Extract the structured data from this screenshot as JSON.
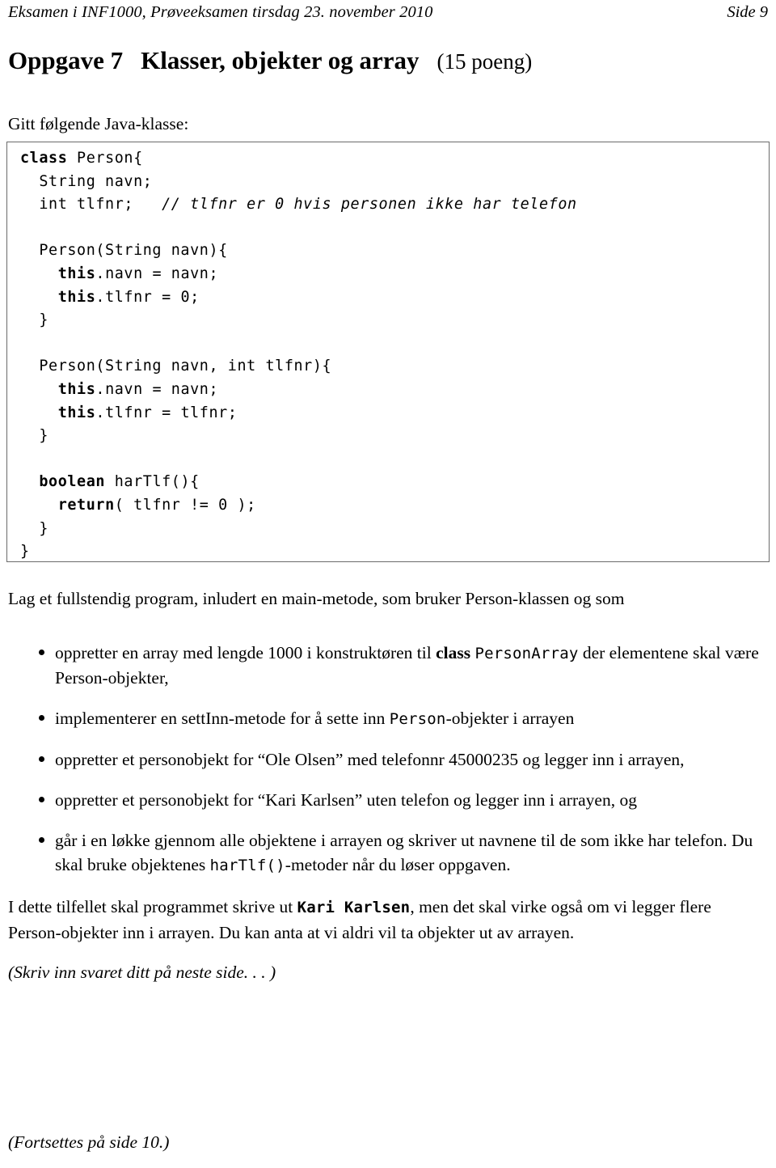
{
  "running_header": {
    "left": "Eksamen i INF1000, Prøveeksamen tirsdag 23. november 2010",
    "right": "Side 9"
  },
  "section": {
    "number_label": "Oppgave 7",
    "title": "Klasser, objekter og array",
    "points": "(15 poeng)"
  },
  "intro_line": "Gitt følgende Java-klasse:",
  "code_block": {
    "language": "java",
    "lines": [
      "class Person{",
      "  String navn;",
      "  int tlfnr;   // tlfnr er 0 hvis personen ikke har telefon",
      "",
      "  Person(String navn){",
      "    this.navn = navn;",
      "    this.tlfnr = 0;",
      "  }",
      "",
      "  Person(String navn, int tlfnr){",
      "    this.navn = navn;",
      "    this.tlfnr = tlfnr;",
      "  }",
      "",
      "  boolean harTlf(){",
      "    return( tlfnr != 0 );",
      "  }",
      "}"
    ],
    "keywords_bold": [
      "class",
      "this",
      "boolean",
      "return"
    ],
    "comment_italic": "// tlfnr er 0 hvis personen ikke har telefon"
  },
  "lead_paragraph": "Lag et fullstendig program, inludert en main-metode, som bruker Person-klassen og som",
  "bullets": [
    {
      "id": "bullet-array-konstruktor",
      "parts": [
        {
          "text": "oppretter en array med lengde 1000 i konstruktøren til ",
          "style": "normal"
        },
        {
          "text": "class",
          "style": "bold"
        },
        {
          "text": " ",
          "style": "normal"
        },
        {
          "text": "PersonArray",
          "style": "mono"
        },
        {
          "text": " der elementene skal være Person-objekter,",
          "style": "normal"
        }
      ]
    },
    {
      "id": "bullet-settinn",
      "parts": [
        {
          "text": "implementerer en settInn-metode for å sette inn ",
          "style": "normal"
        },
        {
          "text": "Person",
          "style": "mono"
        },
        {
          "text": "-objekter i arrayen",
          "style": "normal"
        }
      ]
    },
    {
      "id": "bullet-ole-olsen",
      "parts": [
        {
          "text": "oppretter et personobjekt for “Ole Olsen” med telefonnr 45000235 og legger inn i arrayen,",
          "style": "normal"
        }
      ]
    },
    {
      "id": "bullet-kari-karlsen",
      "parts": [
        {
          "text": "oppretter et personobjekt for “Kari Karlsen” uten telefon og legger inn i arrayen, og",
          "style": "normal"
        }
      ]
    },
    {
      "id": "bullet-lokke",
      "parts": [
        {
          "text": "går i en løkke gjennom alle objektene i arrayen og skriver ut navnene til de som ikke har telefon. Du skal bruke objektenes ",
          "style": "normal"
        },
        {
          "text": "harTlf()",
          "style": "mono"
        },
        {
          "text": "-metoder når du løser oppgaven.",
          "style": "normal"
        }
      ]
    }
  ],
  "closing_paragraph": {
    "parts": [
      {
        "text": "I dette tilfellet skal programmet skrive ut ",
        "style": "normal"
      },
      {
        "text": "Kari Karlsen",
        "style": "mono-bold"
      },
      {
        "text": ", men det skal virke også om vi legger flere Person-objekter inn i arrayen. Du kan anta at vi aldri vil ta objekter ut av arrayen.",
        "style": "normal"
      }
    ]
  },
  "note_line": "(Skriv inn svaret ditt på neste side. . . )",
  "footer_line": "(Fortsettes på side 10.)",
  "colors": {
    "text": "#000000",
    "page_background": "#ffffff",
    "code_border": "#6b6b6b"
  }
}
